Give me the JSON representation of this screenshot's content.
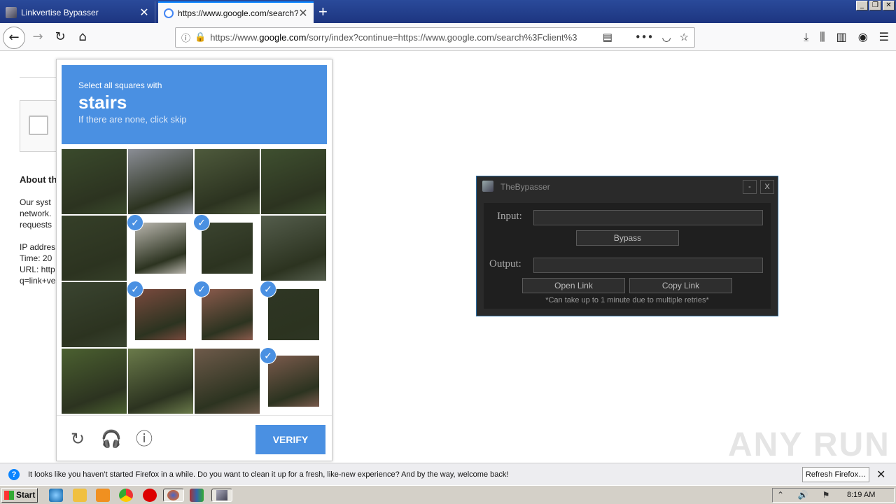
{
  "browser": {
    "tabs": [
      {
        "title": "Linkvertise Bypasser",
        "active": false
      },
      {
        "title": "https://www.google.com/search?c",
        "active": true
      }
    ],
    "newtab_glyph": "+",
    "close_glyph": "✕",
    "window_controls": [
      "_",
      "❐",
      "✕"
    ],
    "url_prefix": "https://www.",
    "url_domain": "google.com",
    "url_rest": "/sorry/index?continue=https://www.google.com/search%3Fclient%3",
    "icons": {
      "back": "back-arrow-icon",
      "forward": "forward-arrow-icon",
      "reload": "reload-icon",
      "home": "home-icon",
      "info": "info-icon",
      "lock": "lock-icon",
      "reader": "reader-view-icon",
      "more": "more-icon",
      "pocket": "pocket-icon",
      "bookmark": "star-icon",
      "download": "download-icon",
      "library": "library-icon",
      "sidebar": "sidebar-icon",
      "account": "account-icon",
      "menu": "hamburger-menu-icon"
    }
  },
  "page": {
    "about_heading": "About th",
    "lines": [
      "Our syst",
      "network.",
      "requests",
      "",
      "IP addres",
      "Time: 20",
      "URL: http",
      "q=link+ve"
    ]
  },
  "captcha": {
    "instruction_small": "Select all squares with",
    "target": "stairs",
    "hint": "If there are none, click skip",
    "verify_label": "VERIFY",
    "check_glyph": "✓",
    "tiles": [
      {
        "row": 0,
        "col": 0,
        "selected": false,
        "color": "#3a4a2c"
      },
      {
        "row": 0,
        "col": 1,
        "selected": false,
        "color": "#8a8d95"
      },
      {
        "row": 0,
        "col": 2,
        "selected": false,
        "color": "#4e5a3c"
      },
      {
        "row": 0,
        "col": 3,
        "selected": false,
        "color": "#3f5030"
      },
      {
        "row": 1,
        "col": 0,
        "selected": false,
        "color": "#353f28"
      },
      {
        "row": 1,
        "col": 1,
        "selected": true,
        "color": "#b9b6ae"
      },
      {
        "row": 1,
        "col": 2,
        "selected": true,
        "color": "#3b4430"
      },
      {
        "row": 1,
        "col": 3,
        "selected": false,
        "color": "#545d4c"
      },
      {
        "row": 2,
        "col": 0,
        "selected": false,
        "color": "#3a4430"
      },
      {
        "row": 2,
        "col": 1,
        "selected": true,
        "color": "#7a4a3e"
      },
      {
        "row": 2,
        "col": 2,
        "selected": true,
        "color": "#8a5a4c"
      },
      {
        "row": 2,
        "col": 3,
        "selected": true,
        "color": "#2e3624"
      },
      {
        "row": 3,
        "col": 0,
        "selected": false,
        "color": "#4b6030"
      },
      {
        "row": 3,
        "col": 1,
        "selected": false,
        "color": "#6a7a4a"
      },
      {
        "row": 3,
        "col": 2,
        "selected": false,
        "color": "#6e5a4a"
      },
      {
        "row": 3,
        "col": 3,
        "selected": true,
        "color": "#7a5a4c"
      }
    ],
    "footer_icons": [
      "reload-icon",
      "headphones-icon",
      "info-icon"
    ]
  },
  "bypasser": {
    "title": "TheBypasser",
    "minimize_label": "-",
    "close_label": "X",
    "input_label": "Input:",
    "input_value": "",
    "bypass_label": "Bypass",
    "output_label": "Output:",
    "output_value": "",
    "open_link_label": "Open Link",
    "copy_link_label": "Copy Link",
    "note": "*Can take up to 1 minute due to multiple retries*"
  },
  "watermark": "ANY RUN",
  "notification": {
    "message": "It looks like you haven’t started Firefox in a while. Do you want to clean it up for a fresh, like-new experience? And by the way, welcome back!",
    "refresh_label": "Refresh Firefox…",
    "close_glyph": "✕",
    "question_glyph": "?"
  },
  "taskbar": {
    "start_label": "Start",
    "apps": [
      "ie-icon",
      "folder-icon",
      "media-player-icon",
      "chrome-icon",
      "opera-icon",
      "firefox-icon",
      "winrar-icon",
      "bypasser-icon"
    ],
    "tray_icons": "⌃ 🔊 ⚑",
    "clock": "8:19 AM"
  },
  "colors": {
    "captcha_blue": "#4a90e2",
    "firefox_tab_accent": "#0a84ff",
    "bypasser_border": "#2d6fa3",
    "lock_green": "#12bc00"
  }
}
